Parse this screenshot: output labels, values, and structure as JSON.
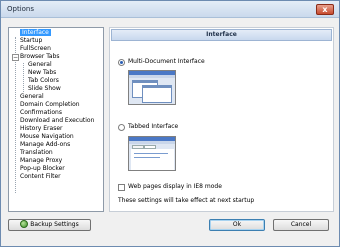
{
  "window": {
    "title": "Options",
    "close_glyph": "x"
  },
  "tree": {
    "items": [
      {
        "label": "Interface",
        "selected": true
      },
      {
        "label": "Startup"
      },
      {
        "label": "FullScreen"
      },
      {
        "label": "Browser Tabs",
        "expander": "−"
      },
      {
        "label": "General"
      },
      {
        "label": "New Tabs"
      },
      {
        "label": "Tab Colors"
      },
      {
        "label": "Slide Show"
      },
      {
        "label": "General"
      },
      {
        "label": "Domain Completion"
      },
      {
        "label": "Confirmations"
      },
      {
        "label": "Download and Execution"
      },
      {
        "label": "History Eraser"
      },
      {
        "label": "Mouse Navigation"
      },
      {
        "label": "Manage Add-ons"
      },
      {
        "label": "Translation"
      },
      {
        "label": "Manage Proxy"
      },
      {
        "label": "Pop-up Blocker"
      },
      {
        "label": "Content Filter"
      }
    ]
  },
  "panel": {
    "header": "Interface",
    "options": [
      {
        "label": "Multi-Document Interface",
        "checked": true
      },
      {
        "label": "Tabbed Interface",
        "checked": false
      }
    ],
    "checkbox_label": "Web pages display in IE8 mode",
    "note": "These settings will take effect at next startup"
  },
  "buttons": {
    "backup": "Backup Settings",
    "ok": "Ok",
    "cancel": "Cancel"
  },
  "colors": {
    "selection": "#3399ff",
    "panel_header": "#c8d8ee",
    "close_button": "#c74b2f"
  }
}
